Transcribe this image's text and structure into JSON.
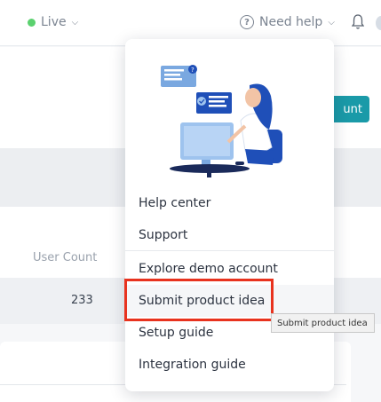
{
  "topbar": {
    "env_label": "Live",
    "help_label": "Need help"
  },
  "main": {
    "action_button_label": "unt",
    "user_count_header": "User Count",
    "user_count_value": "233"
  },
  "dropdown": {
    "items": [
      {
        "label": "Help center"
      },
      {
        "label": "Support"
      },
      {
        "label": "Explore demo account"
      },
      {
        "label": "Submit product idea"
      },
      {
        "label": "Setup guide"
      },
      {
        "label": "Integration guide"
      }
    ]
  },
  "tooltip": {
    "text": "Submit product idea"
  },
  "colors": {
    "live_dot": "#5bd16f",
    "accent_teal": "#1a9aa8",
    "highlight_red": "#e8321e"
  }
}
